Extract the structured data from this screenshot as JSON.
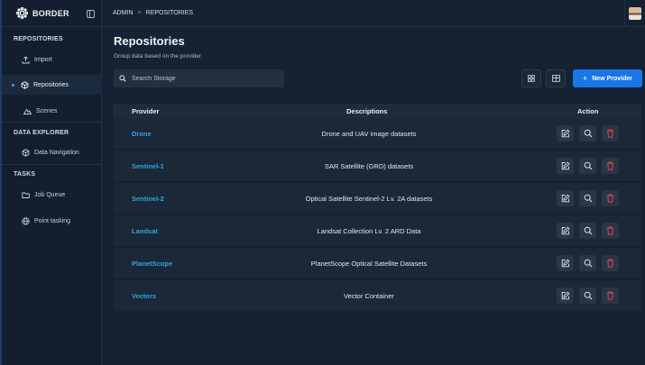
{
  "brand": {
    "name": "BORDER"
  },
  "sidebar": {
    "sections": [
      {
        "title": "REPOSITORIES",
        "items": [
          {
            "label": "Import",
            "icon": "upload-icon"
          },
          {
            "label": "Repositories",
            "icon": "cube-icon",
            "active": true
          },
          {
            "label": "Scenes",
            "icon": "mountain-icon"
          }
        ]
      },
      {
        "title": "DATA EXPLORER",
        "items": [
          {
            "label": "Data Navigation",
            "icon": "cube-icon"
          }
        ]
      },
      {
        "title": "TASKS",
        "items": [
          {
            "label": "Job Queue",
            "icon": "folder-icon"
          },
          {
            "label": "Point tasking",
            "icon": "globe-icon"
          }
        ]
      }
    ]
  },
  "breadcrumb": {
    "root": "ADMIN",
    "separator": ">",
    "current": "REPOSITORIES"
  },
  "page": {
    "title": "Repositories",
    "subtitle": "Group data based on the provider",
    "search_placeholder": "Search Storage",
    "new_button": "New Provider",
    "new_button_icon": "+"
  },
  "table": {
    "headers": {
      "provider": "Provider",
      "descriptions": "Descriptions",
      "action": "Action"
    },
    "rows": [
      {
        "provider": "Drone",
        "description": "Drone and UAV image datasets"
      },
      {
        "provider": "Sentinel-1",
        "description": "SAR Satellite (GRD) datasets"
      },
      {
        "provider": "Sentinel-2",
        "description": "Optical Satellite Sentinel-2 Lv. 2A datasets"
      },
      {
        "provider": "Landsat",
        "description": "Landsat Collection Lv. 2 ARD Data"
      },
      {
        "provider": "PlanetScope",
        "description": "PlanetScope Optical Satellite Datasets"
      },
      {
        "provider": "Vectors",
        "description": "Vector Container"
      }
    ]
  },
  "colors": {
    "accent": "#1976e6",
    "link": "#36a3e0",
    "delete": "#e5484d"
  }
}
